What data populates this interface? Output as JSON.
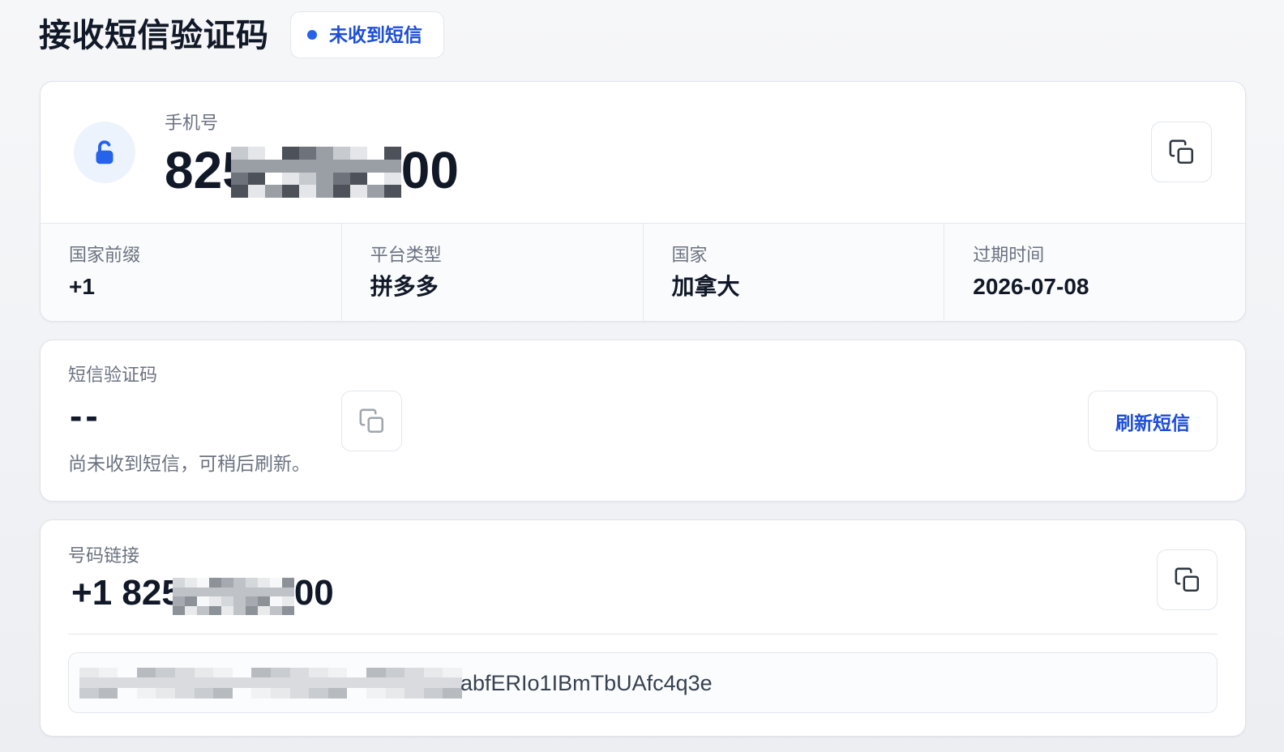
{
  "header": {
    "title": "接收短信验证码",
    "status_badge": "未收到短信"
  },
  "phone_card": {
    "label": "手机号",
    "number_start": "825",
    "number_end": "00",
    "details": [
      {
        "label": "国家前缀",
        "value": "+1"
      },
      {
        "label": "平台类型",
        "value": "拼多多"
      },
      {
        "label": "国家",
        "value": "加拿大"
      },
      {
        "label": "过期时间",
        "value": "2026-07-08"
      }
    ]
  },
  "sms_card": {
    "label": "短信验证码",
    "code": "--",
    "hint": "尚未收到短信，可稍后刷新。",
    "refresh_button": "刷新短信"
  },
  "link_card": {
    "label": "号码链接",
    "number_start": "+1 825",
    "number_end": "00",
    "url_end": "abfERIo1IBmTbUAfc4q3e"
  },
  "icons": {
    "status": "dot-icon",
    "phone": "unlock-icon",
    "copy": "copy-icon"
  },
  "colors": {
    "accent": "#2563eb",
    "accent_text": "#1d4ed8",
    "text": "#111827",
    "muted": "#6b7280",
    "border": "#e3e7ec",
    "icon_circle": "#edf3fc"
  }
}
